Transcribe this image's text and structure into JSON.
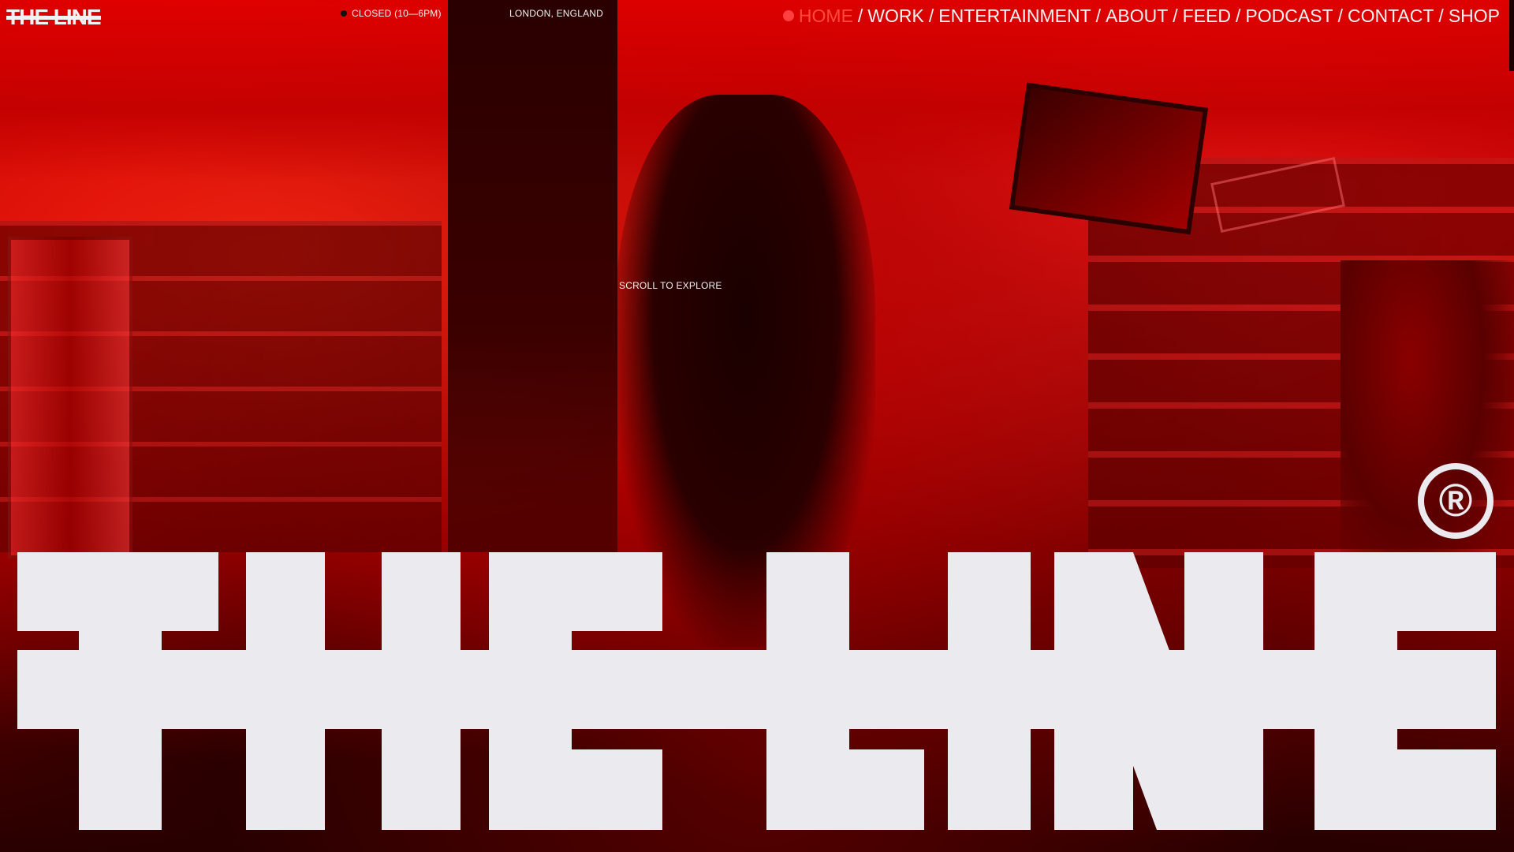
{
  "brand": {
    "logo_text": "THE LINE",
    "wordmark_text": "THE LINE",
    "registered_mark": "®",
    "wordmark_color": "#ebebef"
  },
  "header": {
    "status_text": "CLOSED (10—6PM)",
    "location_text": "LONDON, ENGLAND"
  },
  "nav": {
    "separator": "/",
    "items": [
      {
        "label": "HOME",
        "active": true
      },
      {
        "label": "WORK",
        "active": false
      },
      {
        "label": "ENTERTAINMENT",
        "active": false
      },
      {
        "label": "ABOUT",
        "active": false
      },
      {
        "label": "FEED",
        "active": false
      },
      {
        "label": "PODCAST",
        "active": false
      },
      {
        "label": "CONTACT",
        "active": false
      },
      {
        "label": "SHOP",
        "active": false
      }
    ],
    "active_color": "#ff4a3d"
  },
  "hero": {
    "scroll_hint": "SCROLL TO EXPLORE",
    "background_tint": "#d40000"
  }
}
